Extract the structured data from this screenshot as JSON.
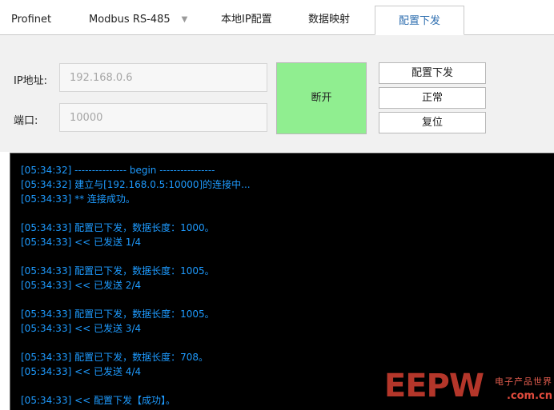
{
  "tabs": [
    {
      "label": "Profinet"
    },
    {
      "label": "Modbus RS-485"
    },
    {
      "label": "本地IP配置"
    },
    {
      "label": "数据映射"
    },
    {
      "label": "配置下发"
    }
  ],
  "connection": {
    "ip_label": "IP地址:",
    "ip_value": "192.168.0.6",
    "port_label": "端口:",
    "port_value": "10000",
    "disconnect_label": "断开"
  },
  "actions": {
    "deploy_label": "配置下发",
    "normal_label": "正常",
    "reset_label": "复位"
  },
  "colors": {
    "log_text": "#1e9bff",
    "connect_button": "#90ee90",
    "active_tab_text": "#2f6fb0"
  },
  "log": [
    "[05:34:32] --------------- begin ----------------",
    "[05:34:32] 建立与[192.168.0.5:10000]的连接中...",
    "[05:34:33] ** 连接成功。",
    "",
    "[05:34:33] 配置已下发，数据长度：1000。",
    "[05:34:33] << 已发送 1/4",
    "",
    "[05:34:33] 配置已下发，数据长度：1005。",
    "[05:34:33] << 已发送 2/4",
    "",
    "[05:34:33] 配置已下发，数据长度：1005。",
    "[05:34:33] << 已发送 3/4",
    "",
    "[05:34:33] 配置已下发，数据长度：708。",
    "[05:34:33] << 已发送 4/4",
    "",
    "[05:34:33] << 配置下发【成功】。"
  ],
  "watermark": {
    "brand": "EEPW",
    "tagline": "电子产品世界",
    "domain": ".com.cn"
  }
}
